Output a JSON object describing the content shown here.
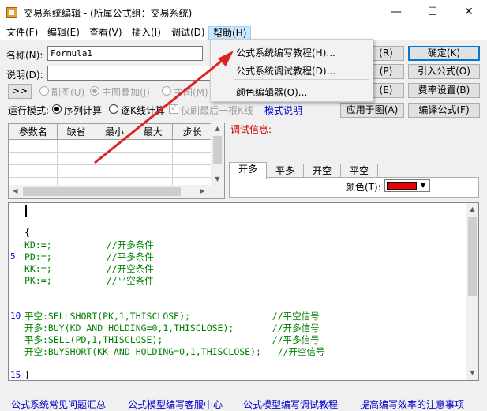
{
  "window": {
    "title": "交易系统编辑 - (所属公式组：交易系统)",
    "min_glyph": "—",
    "max_glyph": "☐",
    "close_glyph": "✕"
  },
  "menu": {
    "file": "文件(F)",
    "edit": "编辑(E)",
    "view": "查看(V)",
    "insert": "插入(I)",
    "debug": "调试(D)",
    "help": "帮助(H)"
  },
  "help_menu": {
    "items": [
      "公式系统编写教程(H)...",
      "公式系统调试教程(D)...",
      "颜色编辑器(O)..."
    ]
  },
  "form": {
    "name_label": "名称(N):",
    "name_value": "Formula1",
    "desc_label": "说明(D):",
    "expand_btn": ">>",
    "sub_chart": "副图(U)",
    "main_overlay": "主图叠加(J)",
    "main_chart_partial": "主图(M)",
    "run_mode_label": "运行模式:",
    "seq_calc": "序列计算",
    "bar_calc": "逐K线计算",
    "last_bar_only": "仅刷最后一根K线",
    "mode_help_link": "模式说明"
  },
  "buttons": {
    "right_a": "(R)",
    "right_b": "(P)",
    "right_c": "(E)",
    "ok": "确定(K)",
    "import_formula": "引入公式(O)",
    "rate_settings": "费率设置(B)",
    "apply_to_chart": "应用于图(A)",
    "compile": "编译公式(F)"
  },
  "params_table": {
    "headers": [
      "参数名",
      "缺省",
      "最小",
      "最大",
      "步长"
    ]
  },
  "debug": {
    "label": "调试信息:"
  },
  "tabs": [
    "开多",
    "平多",
    "开空",
    "平空"
  ],
  "color": {
    "label": "颜色(T):",
    "value": "#ee0000"
  },
  "code": {
    "lines": [
      "{",
      "KD:=;          //开多条件",
      "PD:=;          //平多条件",
      "KK:=;          //开空条件",
      "PK:=;          //平空条件",
      "平空:SELLSHORT(PK,1,THISCLOSE);               //平空信号",
      "开多:BUY(KD AND HOLDING=0,1,THISCLOSE);       //开多信号",
      "平多:SELL(PD,1,THISCLOSE);                    //平多信号",
      "开空:BUYSHORT(KK AND HOLDING=0,1,THISCLOSE);   //开空信号",
      "}"
    ],
    "line_numbers": [
      "5",
      "10",
      "15"
    ]
  },
  "bottom_links": [
    "公式系统常见问题汇总",
    "公式模型编写客服中心",
    "公式模型编写调试教程",
    "提高编写效率的注意事项"
  ]
}
